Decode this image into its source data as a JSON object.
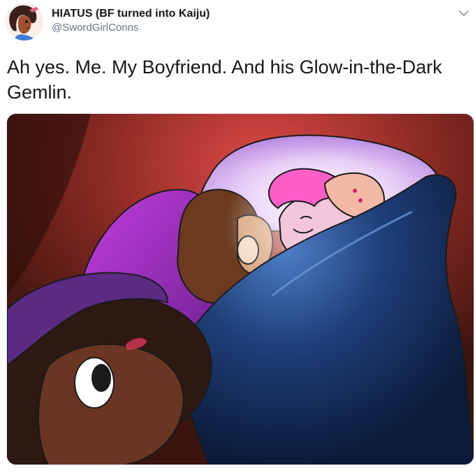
{
  "tweet": {
    "display_name": "HIATUS (BF turned into Kaiju)",
    "handle": "@SwordGirlConns",
    "text": "Ah yes. Me. My Boyfriend. And his Glow-in-the-Dark Gemlin."
  },
  "icons": {
    "avatar": "avatar-illustration",
    "menu": "chevron-down-icon"
  },
  "colors": {
    "name": "#14171a",
    "handle": "#657786",
    "chevron": "#8899a6",
    "border": "#e1e8ed"
  }
}
